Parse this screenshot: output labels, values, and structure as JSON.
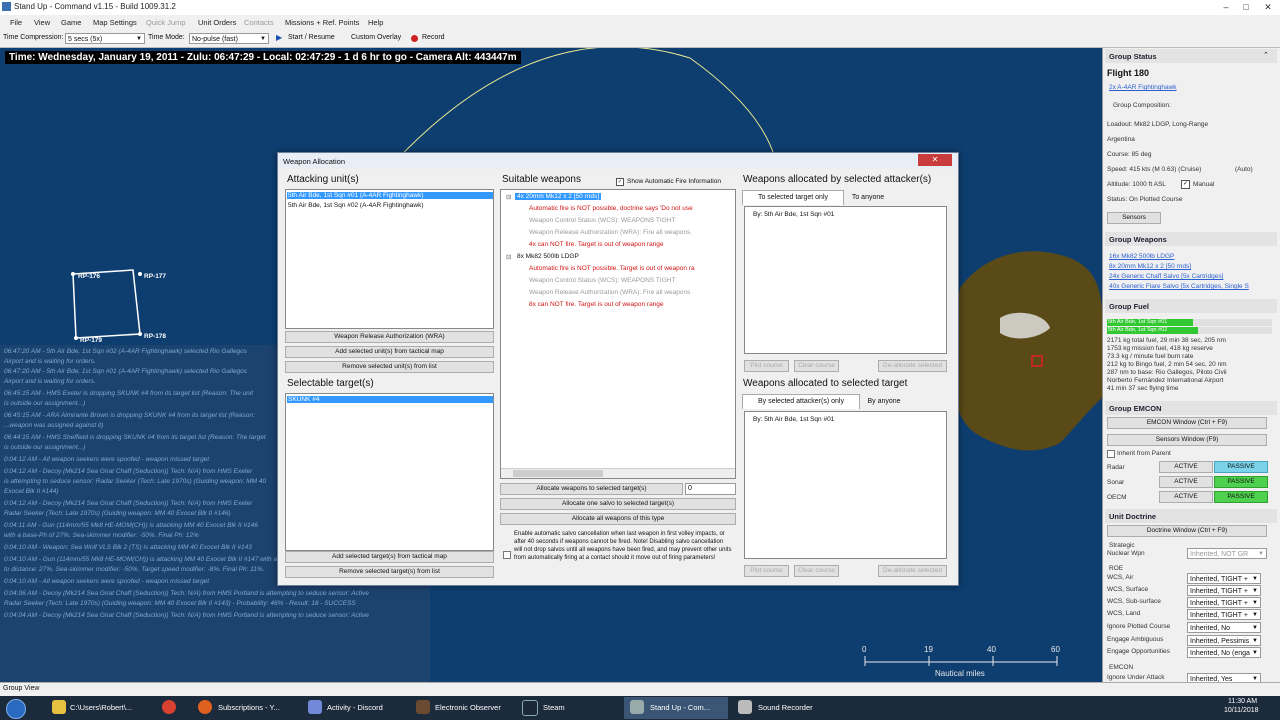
{
  "window": {
    "title": "Stand Up - Command v1.15 - Build 1009.31.2"
  },
  "menu": [
    "File",
    "View",
    "Game",
    "Map Settings",
    "Quick Jump",
    "Unit Orders",
    "Contacts",
    "Missions + Ref. Points",
    "Help"
  ],
  "toolbar": {
    "time_compression_label": "Time Compression:",
    "time_compression_value": "5 secs (5x)",
    "time_mode_label": "Time Mode:",
    "time_mode_value": "No-pulse (fast)",
    "start_resume": "Start / Resume",
    "custom_overlay": "Custom Overlay",
    "record": "Record"
  },
  "status_line": "Time: Wednesday, January 19, 2011 - Zulu: 06:47:29 - Local: 02:47:29 - 1 d 6 hr to go -  Camera Alt: 443447m",
  "map": {
    "ref_points": [
      "RP-176",
      "RP-177",
      "RP-179",
      "RP-178"
    ],
    "scale": {
      "ticks": [
        "0",
        "19",
        "40",
        "60"
      ],
      "label": "Nautical miles"
    }
  },
  "message_log": [
    "06:47:20 AM - 5th Air Bde, 1st Sqn #02 (A-4AR Fightinghawk) selected Rio Gallegos",
    "Airport and is waiting for orders.",
    "06:47:20 AM - 5th Air Bde, 1st Sqn #01 (A-4AR Fightinghawk) selected Rio Gallegos",
    "Airport and is waiting for orders.",
    "06:45:15 AM - HMS Exeter is dropping SKUNK #4 from its target list (Reason: The unit",
    "is outside our assignment...)",
    "06:45:15 AM - ARA Almirante Brown is dropping SKUNK #4 from its target list (Reason:",
    "...weapon was assigned against it)",
    "06:44:15 AM - HMS Sheffield is dropping SKUNK #4 from its target list (Reason: The target",
    "is outside our assignment...)",
    "0:04:12 AM - All weapon seekers were spoofed - weapon missed target",
    "0:04:12 AM - Decoy (Mk214 Sea Gnat Chaff (Seduction)) Tech: N/A) from HMS Exeter",
    "is attempting to seduce sensor: Radar Seeker (Tech: Late 1970s) (Guiding weapon: MM 40",
    "Exocet Blk II #144)",
    "0:04:12 AM - Decoy (Mk214 Sea Gnat Chaff (Seduction)) Tech: N/A) from HMS Exeter",
    "Radar Seeker (Tech: Late 1970s) (Guiding weapon: MM 40 Exocet Blk II #146)",
    "0:04:11 AM - Gun (114mm/55 Mk8 HE-MOM(CH)) is attacking MM 40 Exocet Blk II #146",
    "with a base-Ph of 27%. Sea-skimmer modifier: -50%. Final Ph: 12%",
    "0:04:10 AM - Weapon: Sea Wolf VLS Blk 2 (TS) is attacking MM 40 Exocet Blk II #143",
    "0:04:10 AM - Gun (114mm/55 Mk8 HE-MOM(CH)) is attacking MM 40 Exocet Blk II #147 with a base-Ph adjusted",
    "to distance: 27%. Sea-skimmer modifier: -50%. Target speed modifier: -8%. Final Ph: 11%.",
    "0:04:10 AM - All weapon seekers were spoofed - weapon missed target",
    "0:04:06 AM - Decoy (Mk214 Sea Gnat Chaff (Seduction)) Tech: N/A) from HMS Portland is attempting to seduce sensor: Active",
    "Radar Seeker (Tech: Late 1970s) (Guiding weapon: MM 40 Exocet Blk II #143) - Probability: 46% - Result: 18 - SUCCESS",
    "0:04:04 AM - Decoy (Mk214 Sea Gnat Chaff (Seduction)) Tech: N/A) from HMS Portland is attempting to seduce sensor: Active"
  ],
  "group_status": {
    "header": "Group Status",
    "name": "Flight 180",
    "composition_link": "2x A-4AR Fightinghawk",
    "composition_label": "Group Composition:",
    "loadout": "Loadout: Mk82 LDGP, Long-Range",
    "country": "Argentina",
    "course": "Course: 85 deg",
    "speed": "Speed: 415 kts (M 0.63) (Cruise)",
    "speed_mode": "(Auto)",
    "altitude": "Altitude: 1000 ft ASL",
    "manual_label": "Manual",
    "status": "Status: On Plotted Course",
    "sensors_button": "Sensors"
  },
  "group_weapons": {
    "header": "Group Weapons",
    "items": [
      "16x Mk82 500lb LDGP",
      "8x 20mm Mk12 x 2 [50 rnds]",
      "24x Generic Chaff Salvo [5x Cartridges]",
      "40x Generic Flare Salvo [5x Cartridges, Single S"
    ]
  },
  "group_fuel": {
    "header": "Group Fuel",
    "bars": [
      {
        "label": "5th Air Bde, 1st Sqn #01",
        "fraction": 0.52
      },
      {
        "label": "5th Air Bde, 1st Sqn #02",
        "fraction": 0.55
      }
    ],
    "lines": [
      "2171 kg total fuel, 29 min 38 sec, 205 nm",
      "1753 kg mission fuel, 418 kg reserve",
      "73.3 kg / minute fuel burn rate",
      "212 kg to Bingo fuel, 2 min 54 sec, 20 nm",
      "287 nm to base: Rio Gallegos, Piloto Civil",
      "Norberto Fernández International Airport",
      "41 min 37 sec flying time"
    ]
  },
  "group_emcon": {
    "header": "Group EMCON",
    "emcon_button": "EMCON Window (Ctrl + F9)",
    "sensors_button": "Sensors Window (F9)",
    "inherit_label": "Inherit from Parent",
    "rows": [
      {
        "label": "Radar",
        "active": "ACTIVE",
        "passive": "PASSIVE"
      },
      {
        "label": "Sonar",
        "active": "ACTIVE",
        "passive": "PASSIVE"
      },
      {
        "label": "OECM",
        "active": "ACTIVE",
        "passive": "PASSIVE"
      }
    ]
  },
  "unit_doctrine": {
    "header": "Unit Doctrine",
    "doctrine_button": "Doctrine Window (Ctrl + F9)",
    "strategic_label": "Strategic",
    "rows": [
      {
        "label": "Nuclear Wpn",
        "value": "Inherited, NOT GR"
      },
      {
        "label": "ROE",
        "value": ""
      },
      {
        "label": "WCS, Air",
        "value": "Inherited, TIGHT +"
      },
      {
        "label": "WCS, Surface",
        "value": "Inherited, TIGHT +"
      },
      {
        "label": "WCS, Sub-surface",
        "value": "Inherited, TIGHT +"
      },
      {
        "label": "WCS, Land",
        "value": "Inherited, TIGHT +"
      },
      {
        "label": "Ignore Plotted Course",
        "value": "Inherited, No"
      },
      {
        "label": "Engage Ambiguous",
        "value": "Inherited, Pessimis"
      },
      {
        "label": "Engage Opportunities",
        "value": "Inherited, No (enga"
      },
      {
        "label": "EMCON",
        "value": ""
      },
      {
        "label": "Ignore Under Attack",
        "value": "Inherited, Yes"
      }
    ]
  },
  "dialog": {
    "title": "Weapon Allocation",
    "attacking_header": "Attacking unit(s)",
    "attacking_units": [
      "5th Air Bde, 1st Sqn #01 (A-4AR Fightinghawk)",
      "5th Air Bde, 1st Sqn #02 (A-4AR Fightinghawk)"
    ],
    "wra_button": "Weapon Release Authorization (WRA)",
    "add_units_button": "Add selected unit(s) from tactical map",
    "remove_units_button": "Remove selected unit(s) from list",
    "selectable_header": "Selectable target(s)",
    "targets": [
      "SKUNK #4"
    ],
    "add_targets_button": "Add selected target(s) from tactical map",
    "remove_targets_button": "Remove selected target(s) from list",
    "suitable_header": "Suitable weapons",
    "show_auto_fire_label": "Show Automatic Fire Information",
    "weapon_tree": [
      {
        "name": "4x 20mm Mk12 x 2 [50 rnds]",
        "notes": [
          {
            "text": "Automatic fire is NOT possible, doctrine says 'Do not use",
            "kind": "red"
          },
          {
            "text": "Weapon Control Status (WCS): WEAPONS TIGHT",
            "kind": "gray"
          },
          {
            "text": "Weapon Release Authorization (WRA): Fire all weapons",
            "kind": "gray"
          },
          {
            "text": "4x can NOT fire. Target is out of weapon range",
            "kind": "red"
          }
        ]
      },
      {
        "name": "8x Mk82 500lb LDGP",
        "notes": [
          {
            "text": "Automatic fire is NOT possible. Target is out of weapon ra",
            "kind": "red"
          },
          {
            "text": "Weapon Control Status (WCS): WEAPONS TIGHT",
            "kind": "gray"
          },
          {
            "text": "Weapon Release Authorization (WRA): Fire all weapons",
            "kind": "gray"
          },
          {
            "text": "8x can NOT fire. Target is out of weapon range",
            "kind": "red"
          }
        ]
      }
    ],
    "allocate_to_target_button": "Allocate weapons to selected target(s)",
    "allocate_qty": "0",
    "allocate_salvo_button": "Allocate one salvo to selected target(s)",
    "allocate_all_button": "Allocate all weapons of this type",
    "salvo_note": "Enable automatic salvo cancellation when last weapon in first volley impacts, or after 40 seconds if weapons cannot be fired. Note! Disabling salvo cancellation will not drop salvos until all weapons have been fired, and may prevent other units from automatically firing at a contact should it move out of firing parameters!",
    "by_attacker_header": "Weapons allocated by selected attacker(s)",
    "tab_selected_target": "To selected target only",
    "tab_to_anyone": "To anyone",
    "by_attacker_tree": "By: 5th Air Bde, 1st Sqn #01",
    "to_target_header": "Weapons allocated to selected target",
    "tab_selected_attacker": "By selected attacker(s) only",
    "tab_by_anyone": "By anyone",
    "to_target_tree": "By: 5th Air Bde, 1st Sqn #01",
    "plot_course": "Plot course",
    "clear_course": "Clear course",
    "deallocate": "De-allocate selected"
  },
  "group_view_label": "Group View",
  "taskbar": {
    "items": [
      "C:\\Users\\Robert\\...",
      "Subscriptions - Y...",
      "Activity - Discord",
      "Electronic Observer",
      "Steam",
      "Stand Up - Com...",
      "Sound Recorder"
    ],
    "time": "11:30 AM",
    "date": "10/11/2018"
  },
  "colors": {
    "map_sea": "#0e3e70",
    "land": "#5a4a17",
    "passive_active": "#4ed14e",
    "selected": "#3399ff"
  }
}
